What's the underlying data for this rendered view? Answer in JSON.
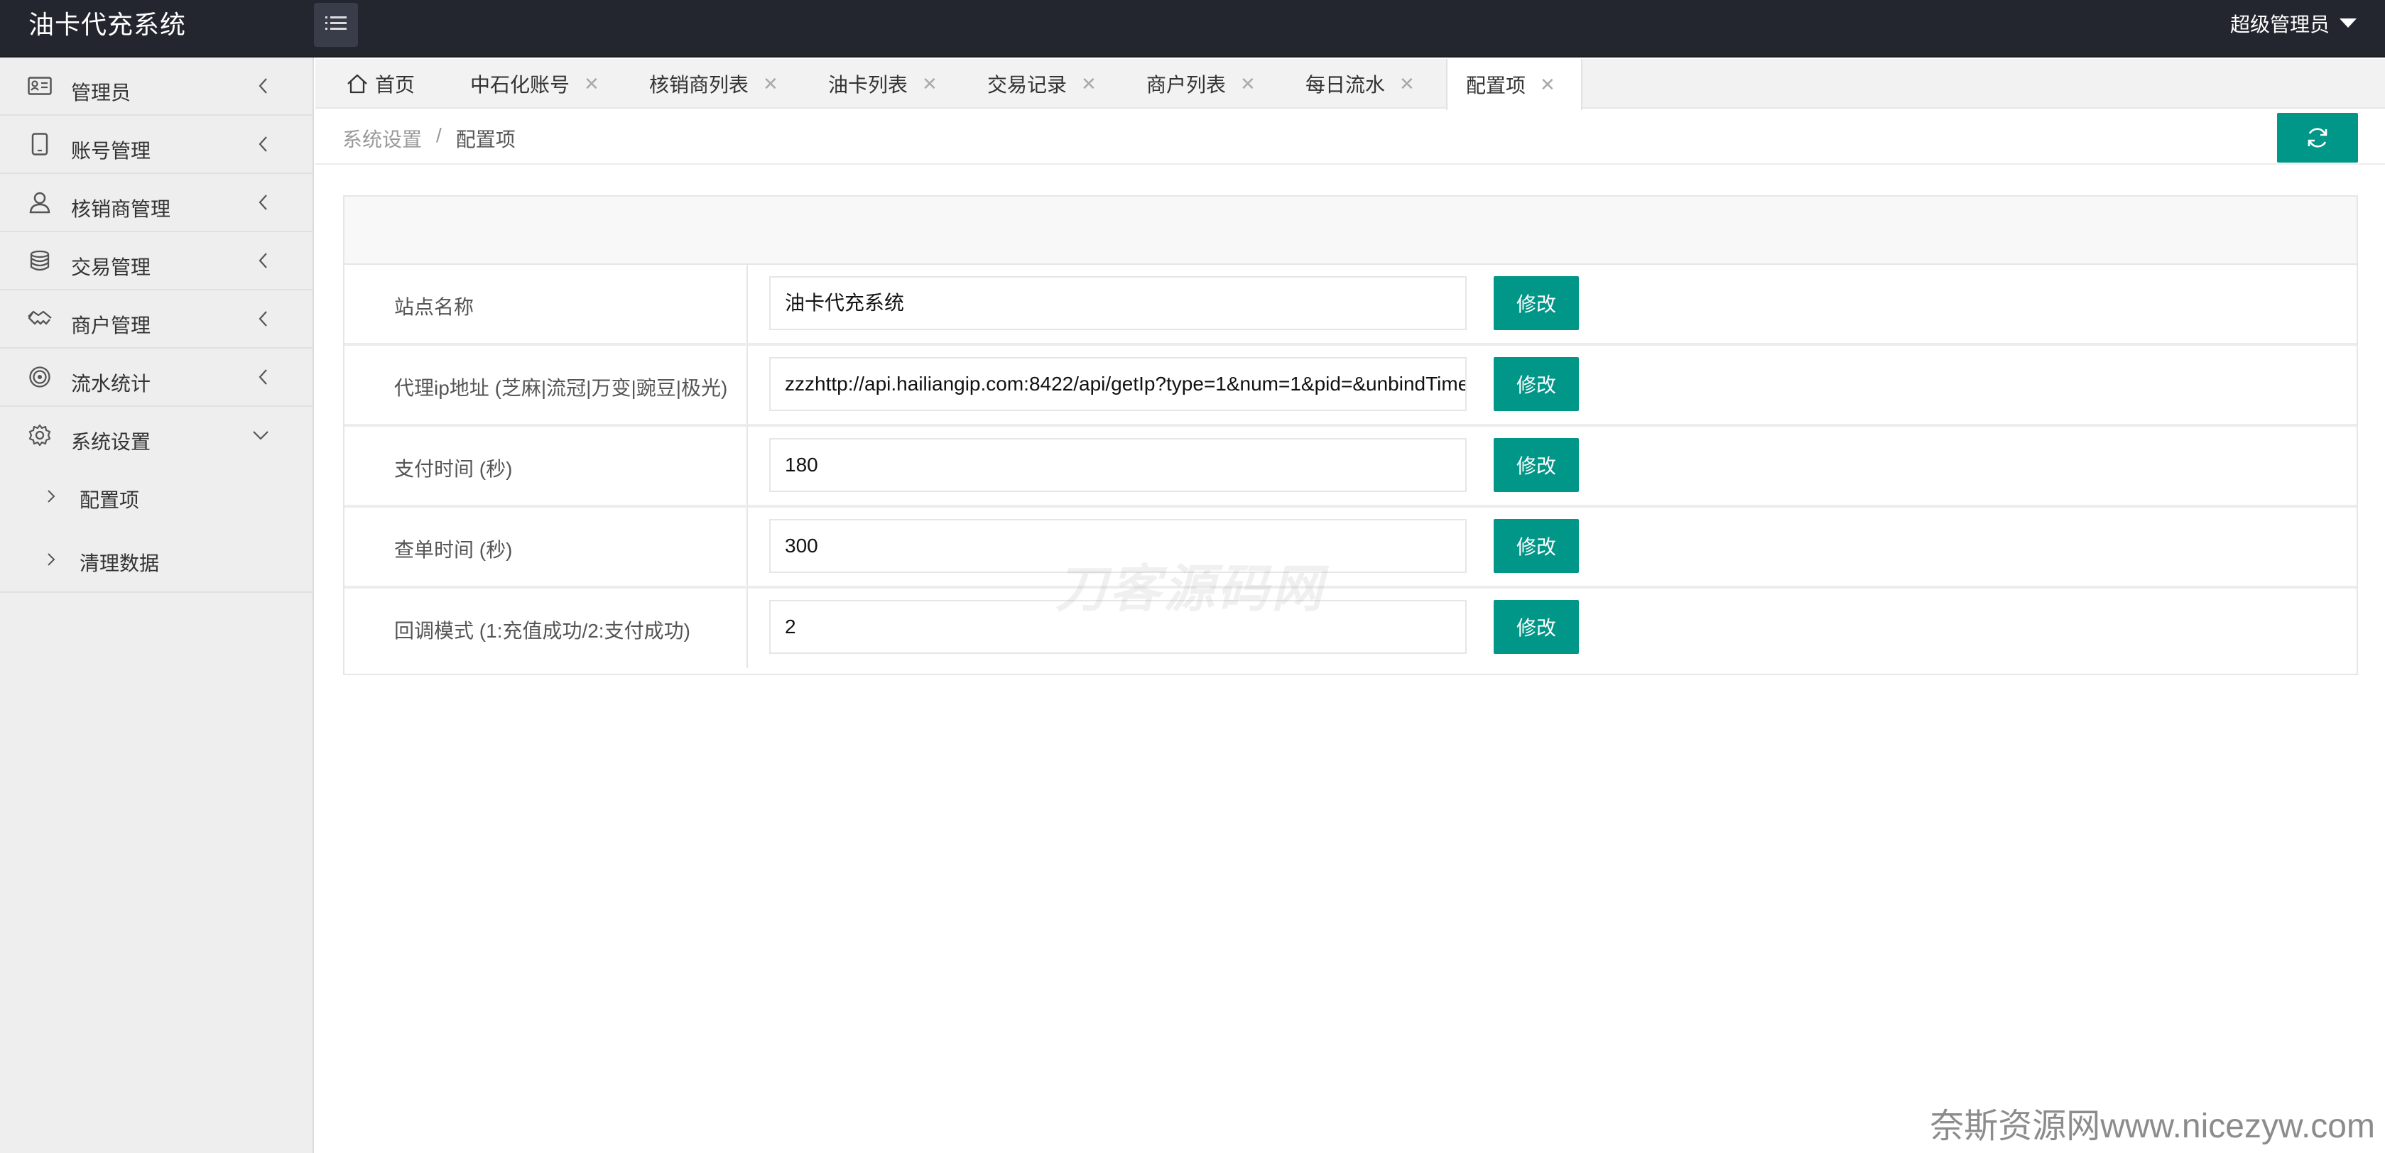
{
  "header": {
    "app_title": "油卡代充系统",
    "user_name": "超级管理员"
  },
  "sidebar": {
    "items": [
      {
        "label": "管理员",
        "icon": "admin-card-icon"
      },
      {
        "label": "账号管理",
        "icon": "phone-icon"
      },
      {
        "label": "核销商管理",
        "icon": "user-icon"
      },
      {
        "label": "交易管理",
        "icon": "database-icon"
      },
      {
        "label": "商户管理",
        "icon": "handshake-icon"
      },
      {
        "label": "流水统计",
        "icon": "target-icon"
      },
      {
        "label": "系统设置",
        "icon": "gear-icon",
        "expanded": true
      }
    ],
    "sub_items": [
      {
        "label": "配置项"
      },
      {
        "label": "清理数据"
      }
    ]
  },
  "tabs": [
    {
      "label": "首页"
    },
    {
      "label": "中石化账号"
    },
    {
      "label": "核销商列表"
    },
    {
      "label": "油卡列表"
    },
    {
      "label": "交易记录"
    },
    {
      "label": "商户列表"
    },
    {
      "label": "每日流水"
    },
    {
      "label": "配置项",
      "active": true
    }
  ],
  "breadcrumb": {
    "parent": "系统设置",
    "separator": "/",
    "current": "配置项"
  },
  "config": {
    "rows": [
      {
        "label": "站点名称",
        "value": "油卡代充系统",
        "button": "修改"
      },
      {
        "label": "代理ip地址 (芝麻|流冠|万变|豌豆|极光)",
        "value": "zzzhttp://api.hailiangip.com:8422/api/getIp?type=1&num=1&pid=&unbindTime",
        "button": "修改"
      },
      {
        "label": "支付时间 (秒)",
        "value": "180",
        "button": "修改"
      },
      {
        "label": "查单时间 (秒)",
        "value": "300",
        "button": "修改"
      },
      {
        "label": "回调模式 (1:充值成功/2:支付成功)",
        "value": "2",
        "button": "修改"
      }
    ]
  },
  "watermarks": {
    "center": "刀客源码网",
    "corner": "奈斯资源网www.nicezyw.com"
  },
  "colors": {
    "header_bg": "#23262e",
    "accent": "#009688",
    "sidebar_bg": "#eeeeee"
  }
}
